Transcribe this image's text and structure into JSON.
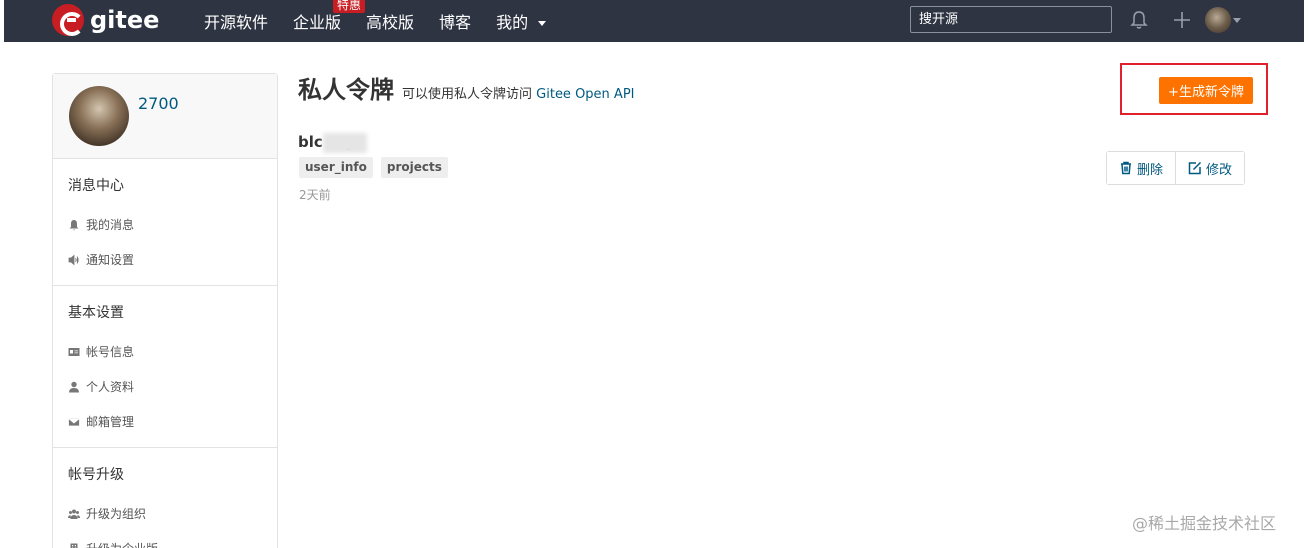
{
  "topbar": {
    "logo_text": "gitee",
    "nav": [
      {
        "label": "开源软件"
      },
      {
        "label": "企业版",
        "badge": "特惠"
      },
      {
        "label": "高校版"
      },
      {
        "label": "博客"
      },
      {
        "label": "我的"
      }
    ],
    "search_placeholder": "搜开源"
  },
  "sidebar": {
    "username": "2700",
    "groups": [
      {
        "title": "消息中心",
        "items": [
          {
            "label": "我的消息",
            "icon": "bell-icon"
          },
          {
            "label": "通知设置",
            "icon": "speaker-icon"
          }
        ]
      },
      {
        "title": "基本设置",
        "items": [
          {
            "label": "帐号信息",
            "icon": "id-card-icon"
          },
          {
            "label": "个人资料",
            "icon": "user-icon"
          },
          {
            "label": "邮箱管理",
            "icon": "mail-icon"
          }
        ]
      },
      {
        "title": "帐号升级",
        "items": [
          {
            "label": "升级为组织",
            "icon": "users-icon"
          },
          {
            "label": "升级为企业版",
            "icon": "building-icon"
          }
        ]
      }
    ]
  },
  "main": {
    "title": "私人令牌",
    "subtitle_prefix": "可以使用私人令牌访问",
    "subtitle_link": "Gitee Open API",
    "create_button": "+生成新令牌",
    "token": {
      "name": "blc      ery",
      "scopes": [
        "user_info",
        "projects"
      ],
      "time": "2天前",
      "delete_label": "删除",
      "edit_label": "修改"
    }
  },
  "watermark": "@稀土掘金技术社区",
  "colors": {
    "topbar": "#2e3442",
    "brand": "#c71d23",
    "link": "#005980",
    "accent": "#fe7300",
    "highlight": "#e0202b"
  }
}
